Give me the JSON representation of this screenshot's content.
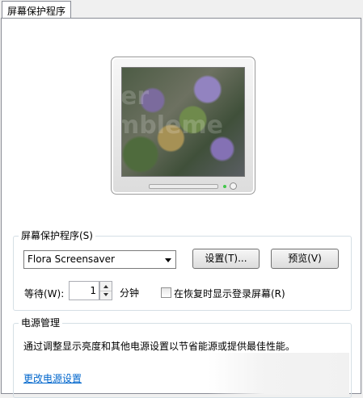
{
  "tab": {
    "label": "屏幕保护程序"
  },
  "preview": {
    "screensaver_text": [
      "er",
      "mbleme"
    ]
  },
  "screensaver_group": {
    "label": "屏幕保护程序(S)",
    "selected": "Flora Screensaver",
    "settings_button": "设置(T)...",
    "preview_button": "预览(V)",
    "wait_label": "等待(W):",
    "wait_value": "1",
    "minutes_label": "分钟",
    "resume_checkbox_label": "在恢复时显示登录屏幕(R)",
    "resume_checked": false
  },
  "power_group": {
    "label": "电源管理",
    "description": "通过调整显示亮度和其他电源设置以节省能源或提供最佳性能。",
    "link": "更改电源设置"
  },
  "colors": {
    "link": "#0066cc",
    "window": "#f0f0f0",
    "panel": "#ffffff"
  }
}
